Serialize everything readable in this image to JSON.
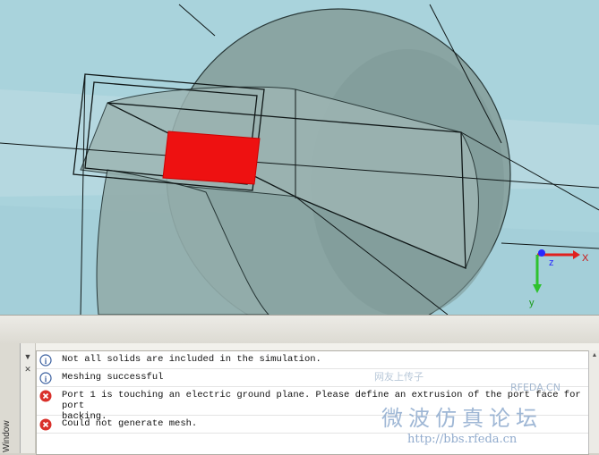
{
  "viewport": {
    "axis_labels": {
      "x": "X",
      "y": "y",
      "z": "z"
    },
    "colors": {
      "background": "#a9d3dc",
      "port_face": "#ee1111",
      "solid": "#86a4a2",
      "axis_x": "#e0201e",
      "axis_y": "#2ec22e",
      "axis_z": "#2828ff"
    }
  },
  "side_tab": {
    "label": "Window"
  },
  "messages": [
    {
      "type": "info",
      "icon": "info-icon",
      "text": "Not all solids are included in the simulation."
    },
    {
      "type": "info",
      "icon": "info-icon",
      "text": "Meshing successful"
    },
    {
      "type": "error",
      "icon": "error-icon",
      "text": "Port 1 is touching an electric ground plane. Please define an extrusion of the port face for port\nbacking."
    },
    {
      "type": "error",
      "icon": "error-icon",
      "text": "Could not generate mesh."
    }
  ],
  "watermark": {
    "line1": "网友上传子",
    "line2": "RFEDA.CN",
    "line3": "微波仿真论坛",
    "line4": "http://bbs.rfeda.cn"
  }
}
